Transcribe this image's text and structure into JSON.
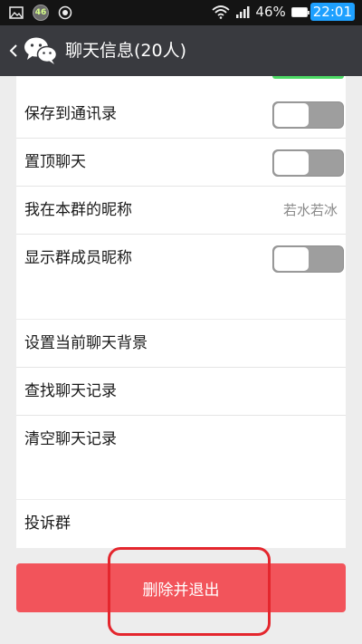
{
  "status_bar": {
    "network_badge": "46",
    "battery_percent": "46%",
    "time": "22:01",
    "icons": [
      "image-icon",
      "network-46-icon",
      "record-icon",
      "wifi-icon",
      "signal-icon",
      "battery-icon"
    ]
  },
  "header": {
    "title": "聊天信息(20人)",
    "back_icon": "chevron-left-icon",
    "logo_icon": "wechat-logo-icon"
  },
  "settings_group1": [
    {
      "label": "保存到通讯录",
      "toggle": "off"
    },
    {
      "label": "置顶聊天",
      "toggle": "off"
    },
    {
      "label": "我在本群的昵称",
      "value": "若水若冰"
    },
    {
      "label": "显示群成员昵称",
      "toggle": "off"
    }
  ],
  "settings_group2": [
    {
      "label": "设置当前聊天背景"
    },
    {
      "label": "查找聊天记录"
    },
    {
      "label": "清空聊天记录"
    }
  ],
  "settings_group3": [
    {
      "label": "投诉群"
    }
  ],
  "exit_button": {
    "label": "删除并退出"
  },
  "colors": {
    "header_bg": "#393a3f",
    "exit_button": "#f2545b",
    "annotation": "#e4262d",
    "toggle_on": "#4cd964"
  }
}
